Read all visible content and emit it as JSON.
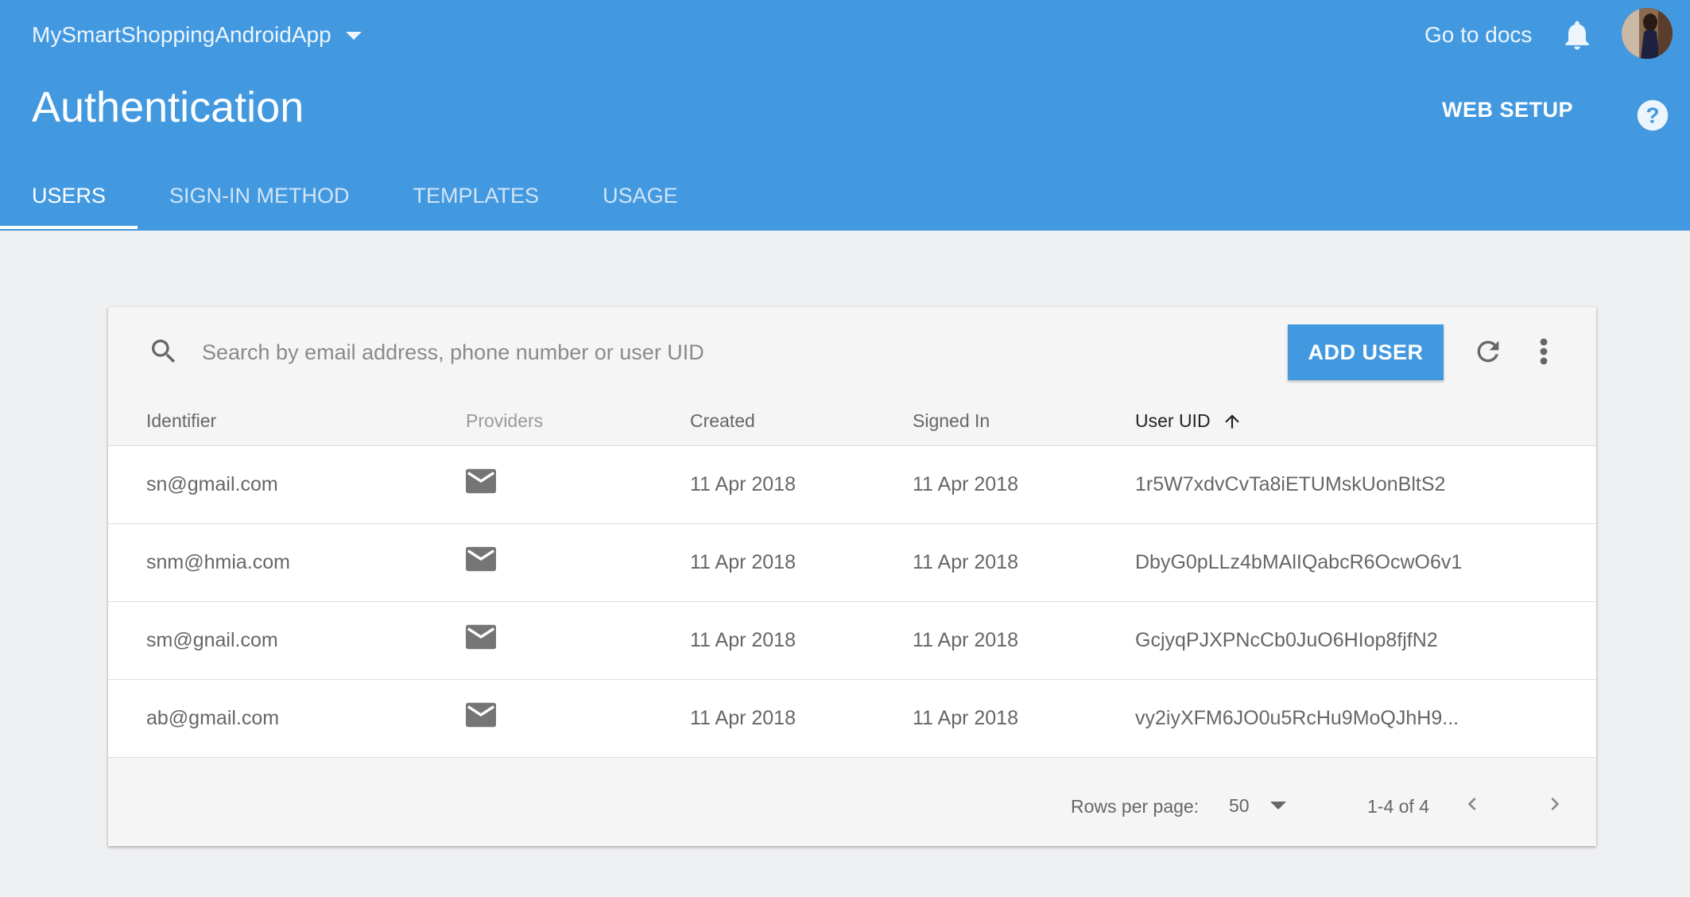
{
  "header": {
    "project_name": "MySmartShoppingAndroidApp",
    "docs_link": "Go to docs",
    "page_title": "Authentication",
    "web_setup": "WEB SETUP",
    "accent_color": "#4399e0"
  },
  "tabs": [
    {
      "label": "USERS",
      "active": true
    },
    {
      "label": "SIGN-IN METHOD",
      "active": false
    },
    {
      "label": "TEMPLATES",
      "active": false
    },
    {
      "label": "USAGE",
      "active": false
    }
  ],
  "toolbar": {
    "search_placeholder": "Search by email address, phone number or user UID",
    "add_user_label": "ADD USER"
  },
  "table": {
    "columns": [
      "Identifier",
      "Providers",
      "Created",
      "Signed In",
      "User UID"
    ],
    "sorted_column": "User UID",
    "sort_direction": "ascending",
    "rows": [
      {
        "identifier": "sn@gmail.com",
        "provider": "email-icon",
        "created": "11 Apr 2018",
        "signed_in": "11 Apr 2018",
        "uid": "1r5W7xdvCvTa8iETUMskUonBltS2"
      },
      {
        "identifier": "snm@hmia.com",
        "provider": "email-icon",
        "created": "11 Apr 2018",
        "signed_in": "11 Apr 2018",
        "uid": "DbyG0pLLz4bMAlIQabcR6OcwO6v1"
      },
      {
        "identifier": "sm@gnail.com",
        "provider": "email-icon",
        "created": "11 Apr 2018",
        "signed_in": "11 Apr 2018",
        "uid": "GcjyqPJXPNcCb0JuO6HIop8fjfN2"
      },
      {
        "identifier": "ab@gmail.com",
        "provider": "email-icon",
        "created": "11 Apr 2018",
        "signed_in": "11 Apr 2018",
        "uid": "vy2iyXFM6JO0u5RcHu9MoQJhH9..."
      }
    ]
  },
  "pagination": {
    "rows_per_page_label": "Rows per page:",
    "rows_per_page_value": "50",
    "range_text": "1-4 of 4"
  }
}
